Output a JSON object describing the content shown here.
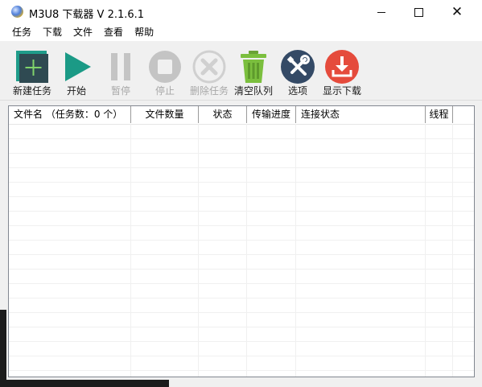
{
  "window": {
    "title": "M3U8 下载器 V 2.1.6.1"
  },
  "menu": {
    "items": [
      "任务",
      "下载",
      "文件",
      "查看",
      "帮助"
    ]
  },
  "toolbar": {
    "buttons": [
      {
        "label": "新建任务",
        "icon": "add-task-icon",
        "enabled": true
      },
      {
        "label": "开始",
        "icon": "play-icon",
        "enabled": true
      },
      {
        "label": "暂停",
        "icon": "pause-icon",
        "enabled": false
      },
      {
        "label": "停止",
        "icon": "stop-icon",
        "enabled": false
      },
      {
        "label": "删除任务",
        "icon": "delete-task-icon",
        "enabled": false
      },
      {
        "label": "清空队列",
        "icon": "trash-icon",
        "enabled": true
      },
      {
        "label": "选项",
        "icon": "settings-tools-icon",
        "enabled": true
      },
      {
        "label": "显示下载",
        "icon": "download-folder-icon",
        "enabled": true
      }
    ]
  },
  "table": {
    "columns": [
      "文件名 （任务数：0 个）",
      "文件数量",
      "状态",
      "传输进度",
      "连接状态",
      "线程"
    ],
    "rows": []
  },
  "colors": {
    "accent_teal": "#1f9c8a",
    "add_tile_dark": "#2f4a52",
    "play_green": "#1b9a86",
    "disabled_gray": "#c4c4c4",
    "trash_green": "#7bbf3e",
    "settings_navy": "#344a66",
    "download_red": "#e54b3c"
  }
}
